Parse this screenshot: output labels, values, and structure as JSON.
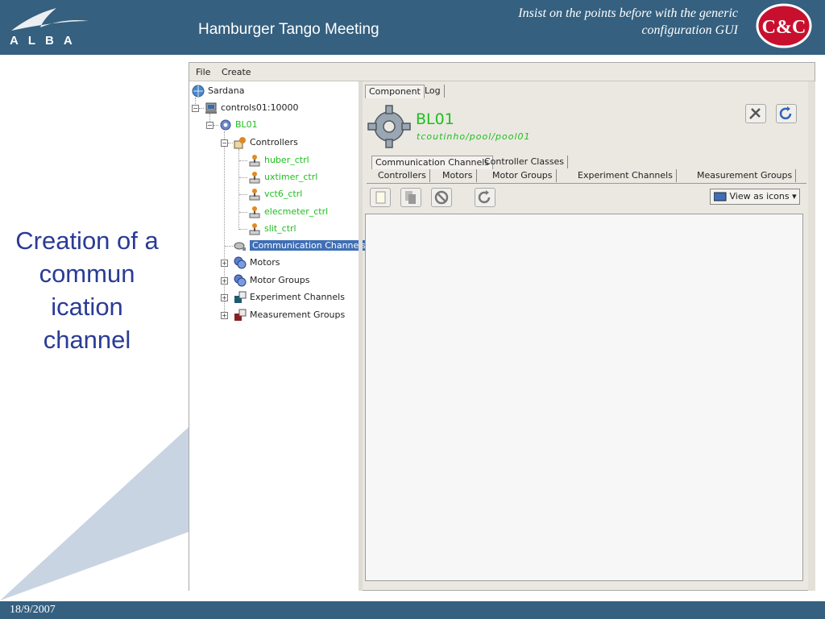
{
  "slide": {
    "logo_text": "ALBA",
    "meeting_title": "Hamburger Tango Meeting",
    "subtitle_line1": "Insist on the points before with the generic",
    "subtitle_line2": "configuration GUI",
    "cc_logo_text": "C&C",
    "caption": "Creation of a commun ication channel",
    "date": "18/9/2007"
  },
  "menu": {
    "file": "File",
    "create": "Create"
  },
  "tree": {
    "root": "Sardana",
    "server": "controls01:10000",
    "pool": "BL01",
    "controllers": "Controllers",
    "controller_items": [
      "huber_ctrl",
      "uxtimer_ctrl",
      "vct6_ctrl",
      "elecmeter_ctrl",
      "slit_ctrl"
    ],
    "comm_channels": "Communication Channels",
    "motors": "Motors",
    "motor_groups": "Motor Groups",
    "experiment_channels": "Experiment Channels",
    "measurement_groups": "Measurement Groups"
  },
  "panel": {
    "tab_component": "Component",
    "tab_log": "Log",
    "name": "BL01",
    "path": "tcoutinho/pool/pool01",
    "tab_comm_channels": "Communication Channels",
    "tab_controller_classes": "Controller Classes",
    "tab_controllers": "Controllers",
    "tab_motors": "Motors",
    "tab_motor_groups": "Motor Groups",
    "tab_experiment_channels": "Experiment Channels",
    "tab_measurement_groups": "Measurement Groups",
    "view_as": "View as icons"
  },
  "colors": {
    "header": "#35607f",
    "caption": "#2a3b96",
    "selected": "#3f6fb5",
    "green_text": "#1fbe1f"
  }
}
